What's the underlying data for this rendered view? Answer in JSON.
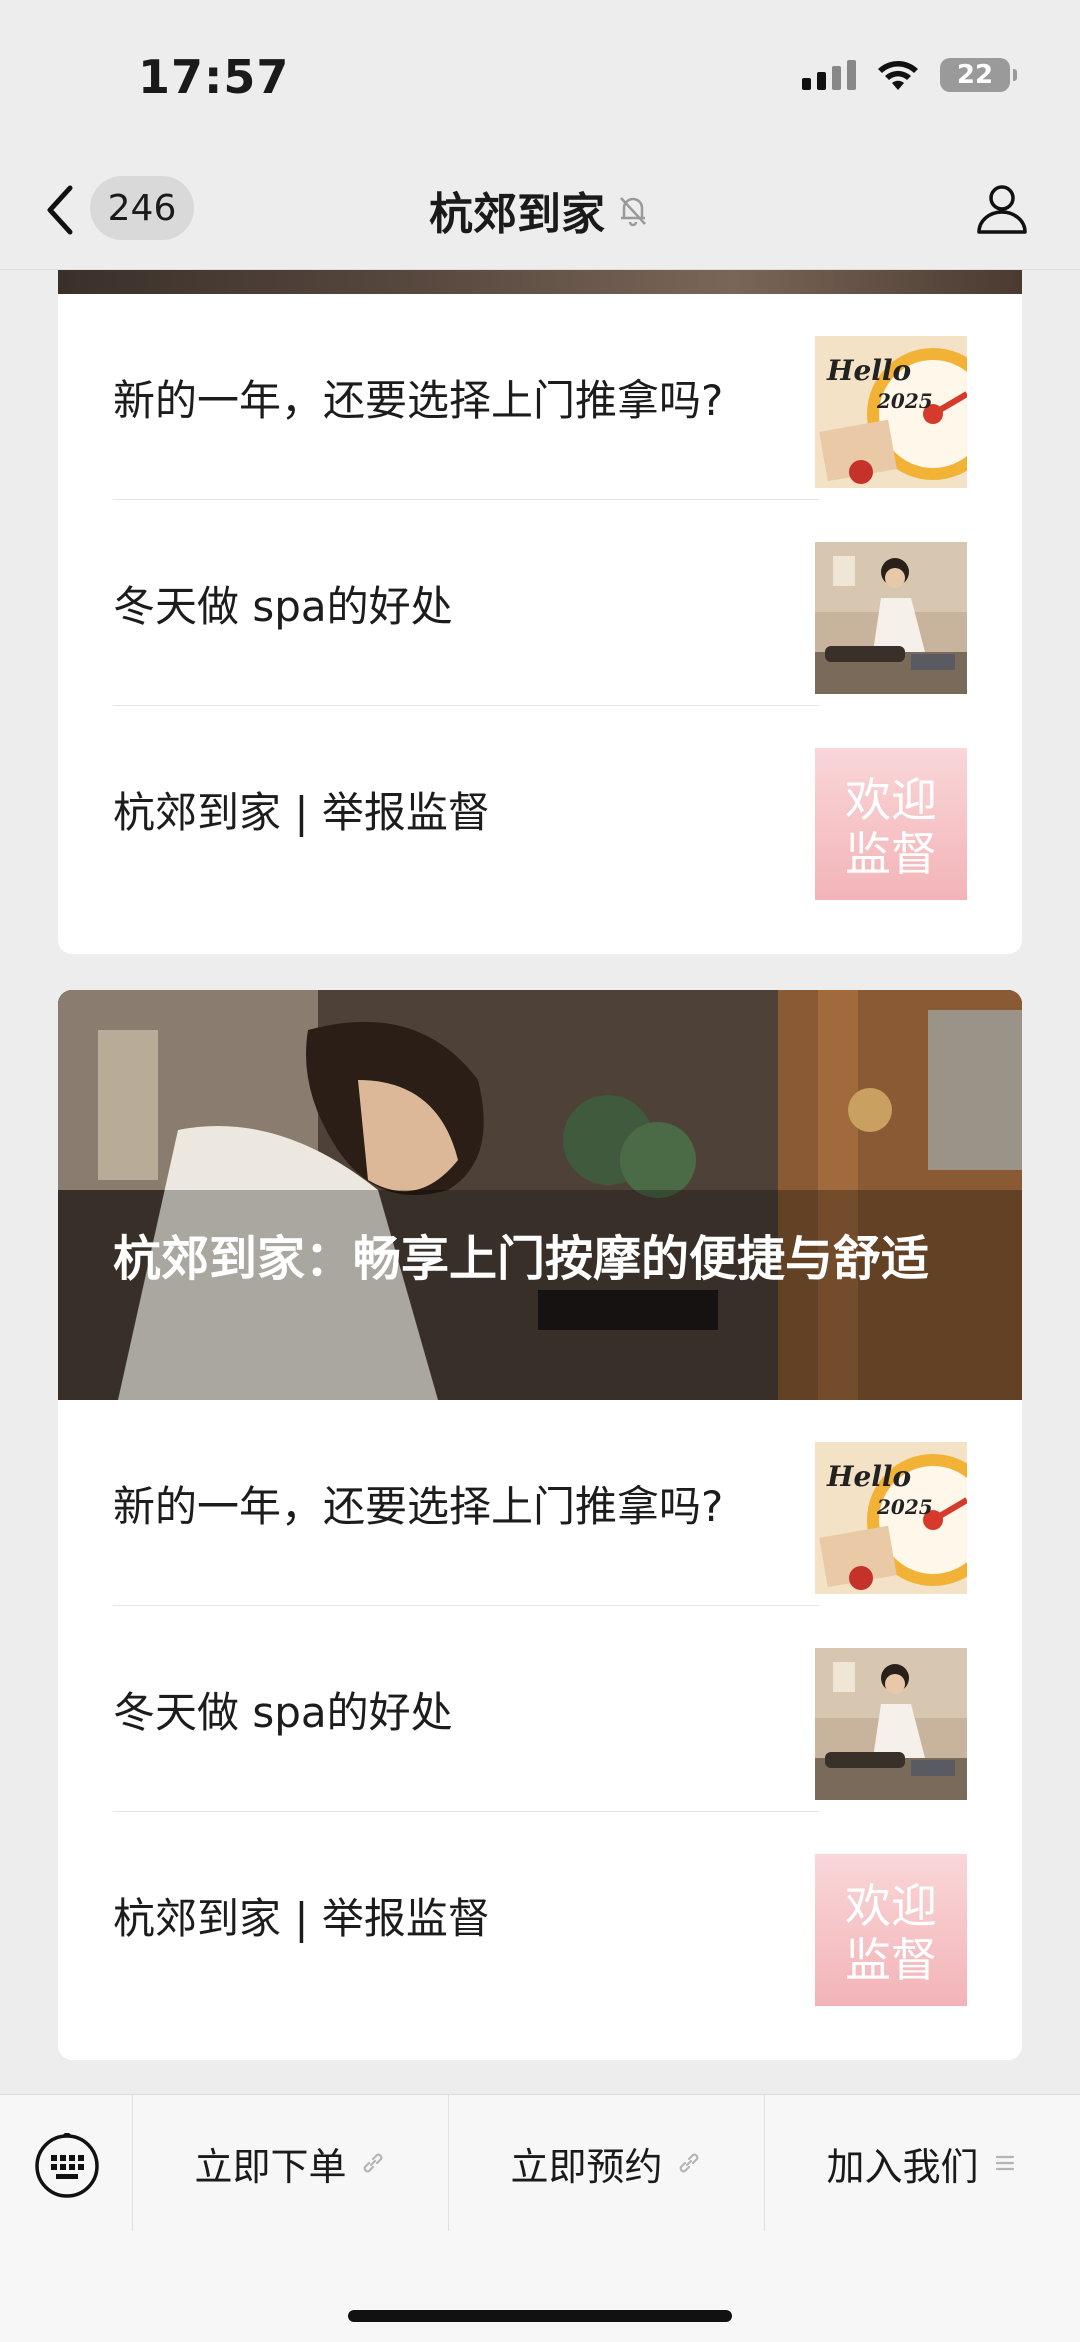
{
  "status": {
    "time": "17:57",
    "battery": "22"
  },
  "nav": {
    "unread_count": "246",
    "title": "杭郊到家"
  },
  "card1": {
    "items": [
      {
        "title": "新的一年，还要选择上门推拿吗?"
      },
      {
        "title": "冬天做 spa的好处"
      },
      {
        "title": "杭郊到家 | 举报监督"
      }
    ]
  },
  "card2": {
    "hero_title": "杭郊到家：畅享上门按摩的便捷与舒适",
    "items": [
      {
        "title": "新的一年，还要选择上门推拿吗?"
      },
      {
        "title": "冬天做 spa的好处"
      },
      {
        "title": "杭郊到家 | 举报监督"
      }
    ]
  },
  "thumbs": {
    "hello_text": "Hello",
    "year_text": "2025",
    "welcome_line1": "欢迎",
    "welcome_line2": "监督"
  },
  "bottom_menu": [
    {
      "label": "立即下单",
      "icon": "link-icon"
    },
    {
      "label": "立即预约",
      "icon": "link-icon"
    },
    {
      "label": "加入我们",
      "icon": "menu-lines-icon"
    }
  ],
  "colors": {
    "accent_pink": "#f6c3c6",
    "clock_yellow": "#f2b236",
    "background": "#ededed"
  }
}
